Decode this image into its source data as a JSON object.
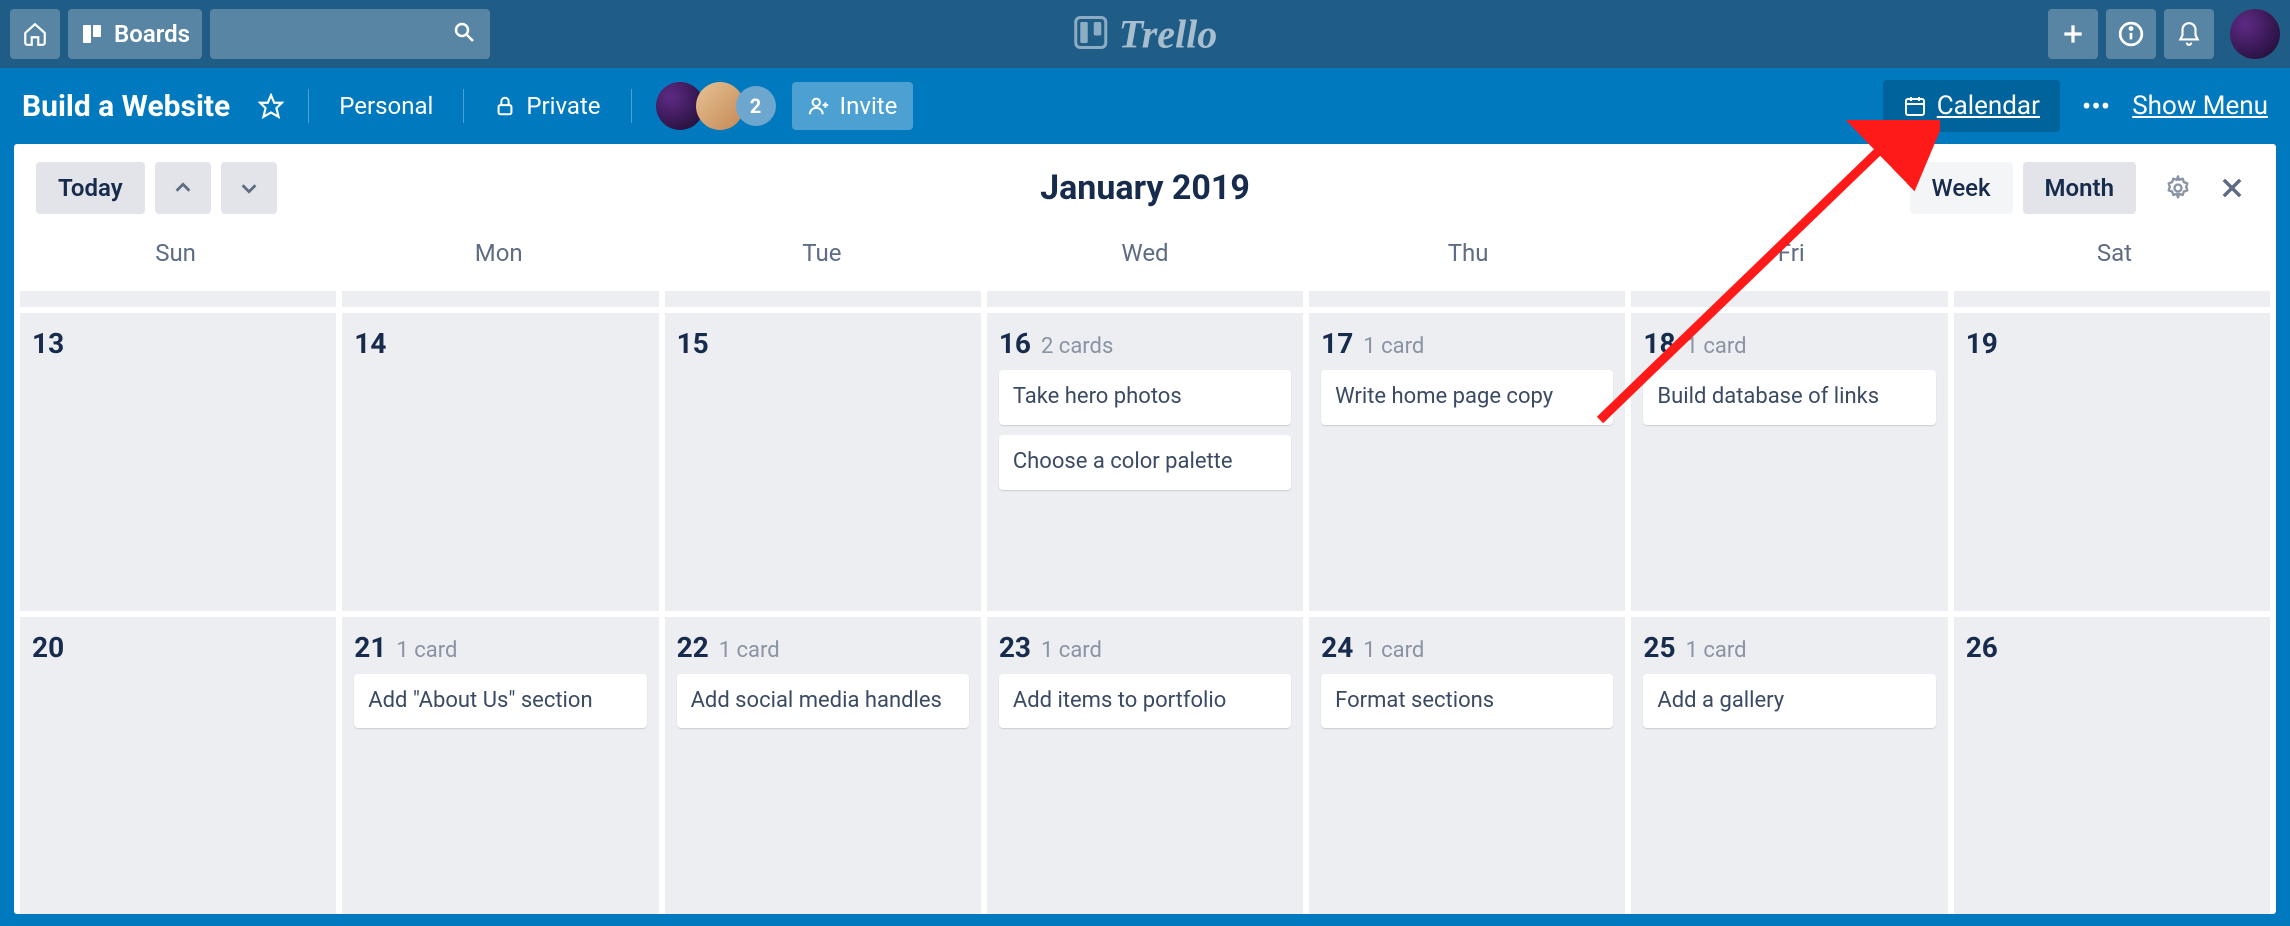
{
  "app": {
    "name": "Trello"
  },
  "header": {
    "boards_label": "Boards",
    "search_placeholder": ""
  },
  "board": {
    "title": "Build a Website",
    "workspace": "Personal",
    "visibility": "Private",
    "member_extra_count": "2",
    "invite_label": "Invite",
    "calendar_label": "Calendar",
    "show_menu_label": "Show Menu"
  },
  "calendar": {
    "today_label": "Today",
    "title": "January 2019",
    "week_label": "Week",
    "month_label": "Month",
    "weekdays": [
      "Sun",
      "Mon",
      "Tue",
      "Wed",
      "Thu",
      "Fri",
      "Sat"
    ],
    "rows": [
      [
        {
          "day": "13",
          "count": "",
          "cards": []
        },
        {
          "day": "14",
          "count": "",
          "cards": []
        },
        {
          "day": "15",
          "count": "",
          "cards": []
        },
        {
          "day": "16",
          "count": "2 cards",
          "cards": [
            "Take hero photos",
            "Choose a color palette"
          ]
        },
        {
          "day": "17",
          "count": "1 card",
          "cards": [
            "Write home page copy"
          ]
        },
        {
          "day": "18",
          "count": "1 card",
          "cards": [
            "Build database of links"
          ]
        },
        {
          "day": "19",
          "count": "",
          "cards": []
        }
      ],
      [
        {
          "day": "20",
          "count": "",
          "cards": []
        },
        {
          "day": "21",
          "count": "1 card",
          "cards": [
            "Add \"About Us\" section"
          ]
        },
        {
          "day": "22",
          "count": "1 card",
          "cards": [
            "Add social media handles"
          ]
        },
        {
          "day": "23",
          "count": "1 card",
          "cards": [
            "Add items to portfolio"
          ]
        },
        {
          "day": "24",
          "count": "1 card",
          "cards": [
            "Format sections"
          ]
        },
        {
          "day": "25",
          "count": "1 card",
          "cards": [
            "Add a gallery"
          ]
        },
        {
          "day": "26",
          "count": "",
          "cards": []
        }
      ]
    ]
  }
}
